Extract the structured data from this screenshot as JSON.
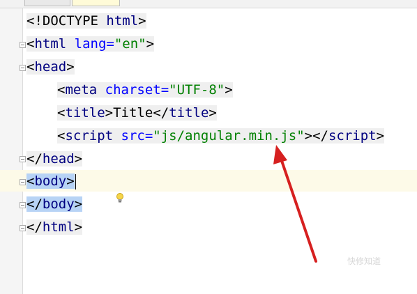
{
  "code_lines": [
    [
      {
        "t": "<!DOCTYPE ",
        "c": "txt"
      },
      {
        "t": "html",
        "c": "tag"
      },
      {
        "t": ">",
        "c": "txt"
      }
    ],
    [
      {
        "t": "<",
        "c": "txt"
      },
      {
        "t": "html ",
        "c": "tag"
      },
      {
        "t": "lang=",
        "c": "attr"
      },
      {
        "t": "\"en\"",
        "c": "str"
      },
      {
        "t": ">",
        "c": "txt"
      }
    ],
    [
      {
        "t": "<",
        "c": "txt"
      },
      {
        "t": "head",
        "c": "tag"
      },
      {
        "t": ">",
        "c": "txt"
      }
    ],
    [
      {
        "t": "<",
        "c": "txt"
      },
      {
        "t": "meta ",
        "c": "tag"
      },
      {
        "t": "charset=",
        "c": "attr"
      },
      {
        "t": "\"UTF-8\"",
        "c": "str"
      },
      {
        "t": ">",
        "c": "txt"
      }
    ],
    [
      {
        "t": "<",
        "c": "txt"
      },
      {
        "t": "title",
        "c": "tag"
      },
      {
        "t": ">",
        "c": "txt"
      },
      {
        "t": "Title",
        "c": "txt"
      },
      {
        "t": "</",
        "c": "txt"
      },
      {
        "t": "title",
        "c": "tag"
      },
      {
        "t": ">",
        "c": "txt"
      }
    ],
    [
      {
        "t": "<",
        "c": "txt"
      },
      {
        "t": "script ",
        "c": "tag"
      },
      {
        "t": "src=",
        "c": "attr"
      },
      {
        "t": "\"js/angular.min.js\"",
        "c": "str"
      },
      {
        "t": "></",
        "c": "txt"
      },
      {
        "t": "script",
        "c": "tag"
      },
      {
        "t": ">",
        "c": "txt"
      }
    ],
    [
      {
        "t": "</",
        "c": "txt"
      },
      {
        "t": "head",
        "c": "tag"
      },
      {
        "t": ">",
        "c": "txt"
      }
    ],
    [
      {
        "t": "<",
        "c": "txt"
      },
      {
        "t": "body",
        "c": "tag"
      },
      {
        "t": ">",
        "c": "txt"
      }
    ],
    [
      {
        "t": "</",
        "c": "txt"
      },
      {
        "t": "body",
        "c": "tag"
      },
      {
        "t": ">",
        "c": "txt"
      }
    ],
    [
      {
        "t": "</",
        "c": "txt"
      },
      {
        "t": "html",
        "c": "tag"
      },
      {
        "t": ">",
        "c": "txt"
      }
    ]
  ],
  "colors": {
    "tag": "#000080",
    "attr": "#0000ff",
    "string": "#008000",
    "selection": "#b7d3f5",
    "current_line": "#fdfae8",
    "arrow": "#d62020"
  },
  "icons": {
    "intention": "lightbulb-icon",
    "annotation": "red-arrow-icon"
  },
  "watermark": "快修知道"
}
